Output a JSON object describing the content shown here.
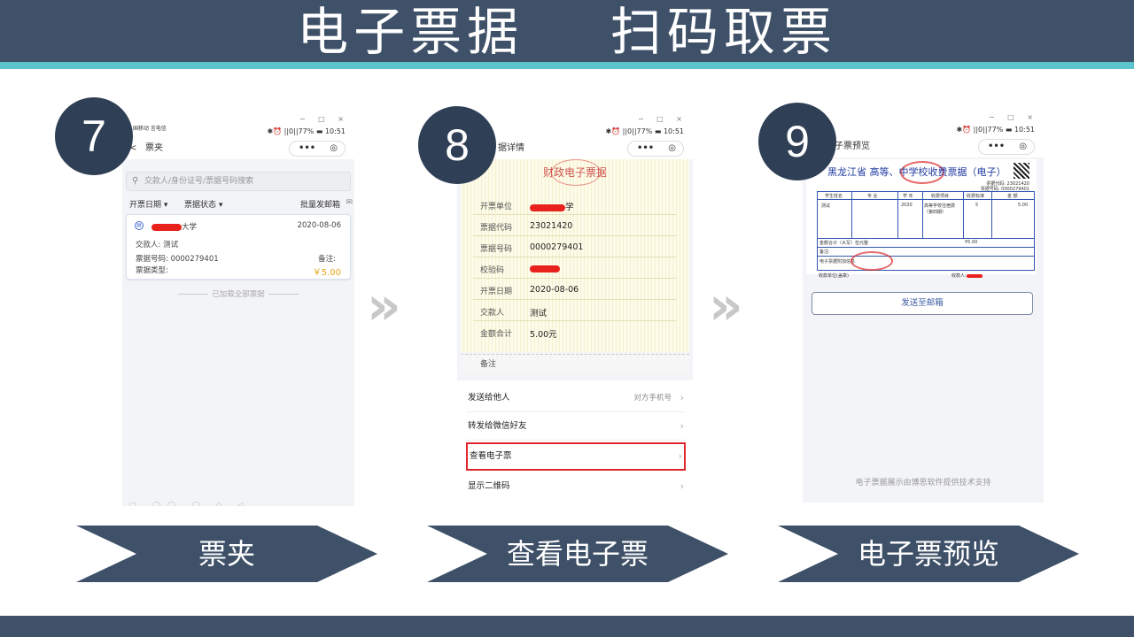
{
  "header": {
    "title": "电子票据    扫码取票"
  },
  "steps": [
    {
      "number": "7",
      "label": "票夹"
    },
    {
      "number": "8",
      "label": "查看电子票"
    },
    {
      "number": "9",
      "label": "电子票预览"
    }
  ],
  "chevron": "»",
  "window": {
    "controls": "− □ ×"
  },
  "status": {
    "carrier": "国移动 言电信",
    "right": "✱⏰ ||0||77% ▬ 10:51"
  },
  "capsule": {
    "dots": "•••",
    "target": "◎"
  },
  "phone1": {
    "nav_title": "票夹",
    "back": "<",
    "search_placeholder": "交款人/身份证号/票据号码搜索",
    "filter_date": "开票日期 ▾",
    "filter_status": "票据状态 ▾",
    "batch_email": "批量发邮箱",
    "ticket": {
      "school_suffix": "大学",
      "date": "2020-08-06",
      "payer": "交款人:  测试",
      "number": "票据号码: 0000279401",
      "type": "票据类型:",
      "remark": "备注:",
      "amount": "￥5.00"
    },
    "loaded_all": "已加载全部票据"
  },
  "phone2": {
    "nav_title": "据详情",
    "paper_title": "财政电子票据",
    "fields": [
      {
        "label": "开票单位",
        "value": "学"
      },
      {
        "label": "票据代码",
        "value": "23021420"
      },
      {
        "label": "票据号码",
        "value": "0000279401"
      },
      {
        "label": "校验码",
        "value": ""
      },
      {
        "label": "开票日期",
        "value": "2020-08-06"
      },
      {
        "label": "交款人",
        "value": "测试"
      },
      {
        "label": "金额合计",
        "value": "5.00元"
      }
    ],
    "remark": "备注",
    "menu": [
      {
        "label": "发送给他人",
        "hint": "对方手机号"
      },
      {
        "label": "转发给微信好友",
        "hint": ""
      },
      {
        "label": "查看电子票",
        "hint": ""
      },
      {
        "label": "显示二维码",
        "hint": ""
      }
    ]
  },
  "phone3": {
    "nav_title": "子票预览",
    "invoice_title": "黑龙江省 高等、中学校收费票据（电子）",
    "invoice_code": "票据代码: 23021420",
    "invoice_number": "票据号码: 0000279401",
    "col_headers": [
      "学生姓名",
      "专 业",
      "学 年",
      "收费项目",
      "收费标准",
      "金 额"
    ],
    "row": [
      "测试",
      "",
      "2020",
      "高等学校住宿费（第四期）",
      "5",
      "5.00"
    ],
    "total": "金额合计（大写）伍元整",
    "total_small": "¥5.00",
    "remark_label": "备注:",
    "attach_label": "电子票据附加信息",
    "payee": "收款单位(盖章)",
    "receiver": "收款人:",
    "send_email": "发送至邮箱",
    "powered_by": "电子票据展示由博思软件提供技术支持"
  }
}
